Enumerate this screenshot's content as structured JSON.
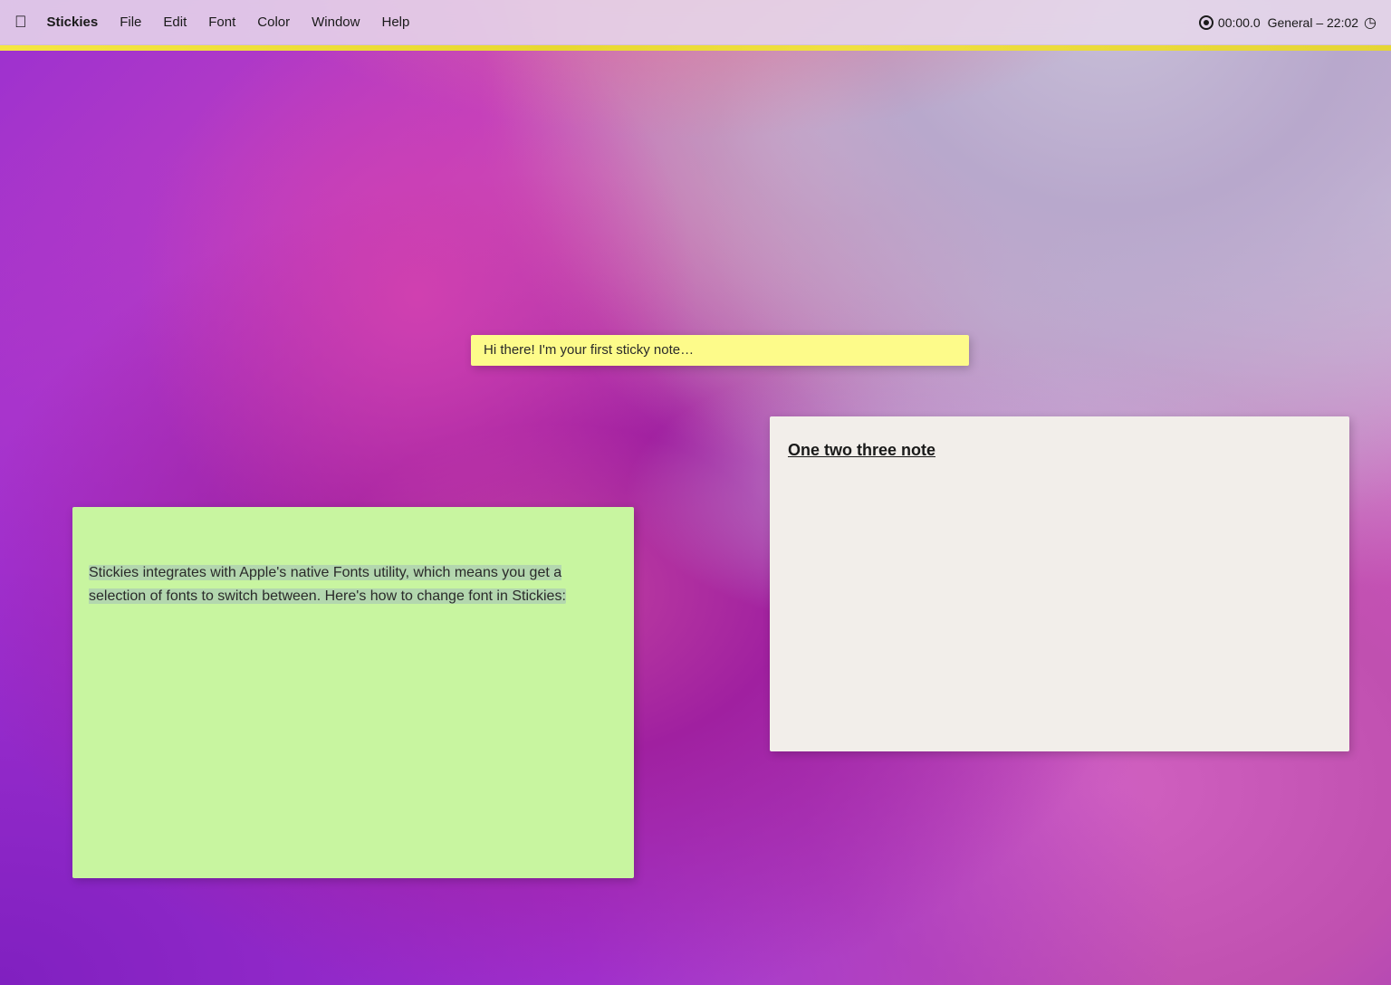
{
  "menubar": {
    "apple_label": "",
    "app_name": "Stickies",
    "menus": [
      {
        "label": "File"
      },
      {
        "label": "Edit"
      },
      {
        "label": "Font"
      },
      {
        "label": "Color"
      },
      {
        "label": "Window"
      },
      {
        "label": "Help"
      }
    ],
    "record": {
      "icon_label": "record-icon",
      "timer": "00:00.0"
    },
    "clock": {
      "label": "General – 22:02",
      "icon_label": "clock-icon"
    }
  },
  "accent_bar": {},
  "sticky_yellow": {
    "text": "Hi there! I'm your first sticky note…"
  },
  "sticky_green": {
    "text": "Stickies integrates with Apple's native Fonts utility, which means you get a selection of fonts to switch between. Here's how to change font in Stickies:"
  },
  "sticky_white": {
    "title": "One two three note",
    "text": ""
  },
  "desktop": {}
}
